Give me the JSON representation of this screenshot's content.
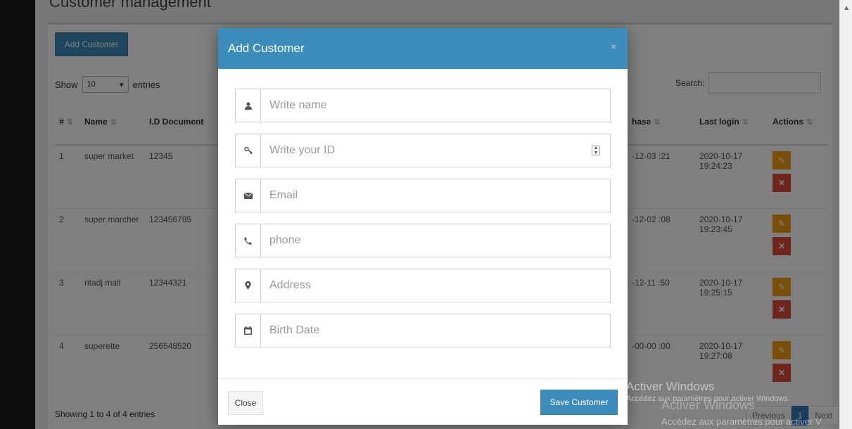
{
  "page": {
    "title": "Customer management"
  },
  "toolbar": {
    "add_label": "Add Customer"
  },
  "list": {
    "show_label": "Show",
    "entries_value": "10",
    "entries_label": "entries",
    "search_label": "Search:",
    "columns": [
      "#",
      "Name",
      "I.D Document",
      "hase",
      "Last login",
      "Actions"
    ],
    "rows": [
      {
        "num": "1",
        "name": "super market",
        "doc": "12345",
        "purchase": "-12-03 :21",
        "login": "2020-10-17 19:24:23"
      },
      {
        "num": "2",
        "name": "super marcher",
        "doc": "123456785",
        "purchase": "-12-02 :08",
        "login": "2020-10-17 19:23:45"
      },
      {
        "num": "3",
        "name": "ritadj mall",
        "doc": "12344321",
        "purchase": "-12-11 :50",
        "login": "2020-10-17 19:25:15"
      },
      {
        "num": "4",
        "name": "superette",
        "doc": "256548520",
        "purchase": "-00-00 :00",
        "login": "2020-10-17 19:27:08"
      }
    ],
    "footer_info": "Showing 1 to 4 of 4 entries",
    "pager": {
      "previous": "Previous",
      "page": "1",
      "next": "Next"
    }
  },
  "modal": {
    "title": "Add Customer",
    "close_x": "×",
    "fields": {
      "name": {
        "placeholder": "Write name",
        "icon": "user-icon"
      },
      "id": {
        "placeholder": "Write your ID",
        "icon": "key-icon"
      },
      "email": {
        "placeholder": "Email",
        "icon": "envelope-icon"
      },
      "phone": {
        "placeholder": "phone",
        "icon": "phone-icon"
      },
      "address": {
        "placeholder": "Address",
        "icon": "map-marker-icon"
      },
      "birth": {
        "placeholder": "Birth Date",
        "icon": "calendar-icon"
      }
    },
    "close_label": "Close",
    "save_label": "Save Customer"
  },
  "watermark": {
    "line1": "Activer Windows",
    "line2": "Accédez aux paramètres pour activer Windows.",
    "line3": "Activer Windows",
    "line4": "Accédez aux paramètres pour activer V"
  },
  "colors": {
    "primary": "#3c8dbc",
    "warning": "#f39c12",
    "danger": "#dd4b39"
  }
}
